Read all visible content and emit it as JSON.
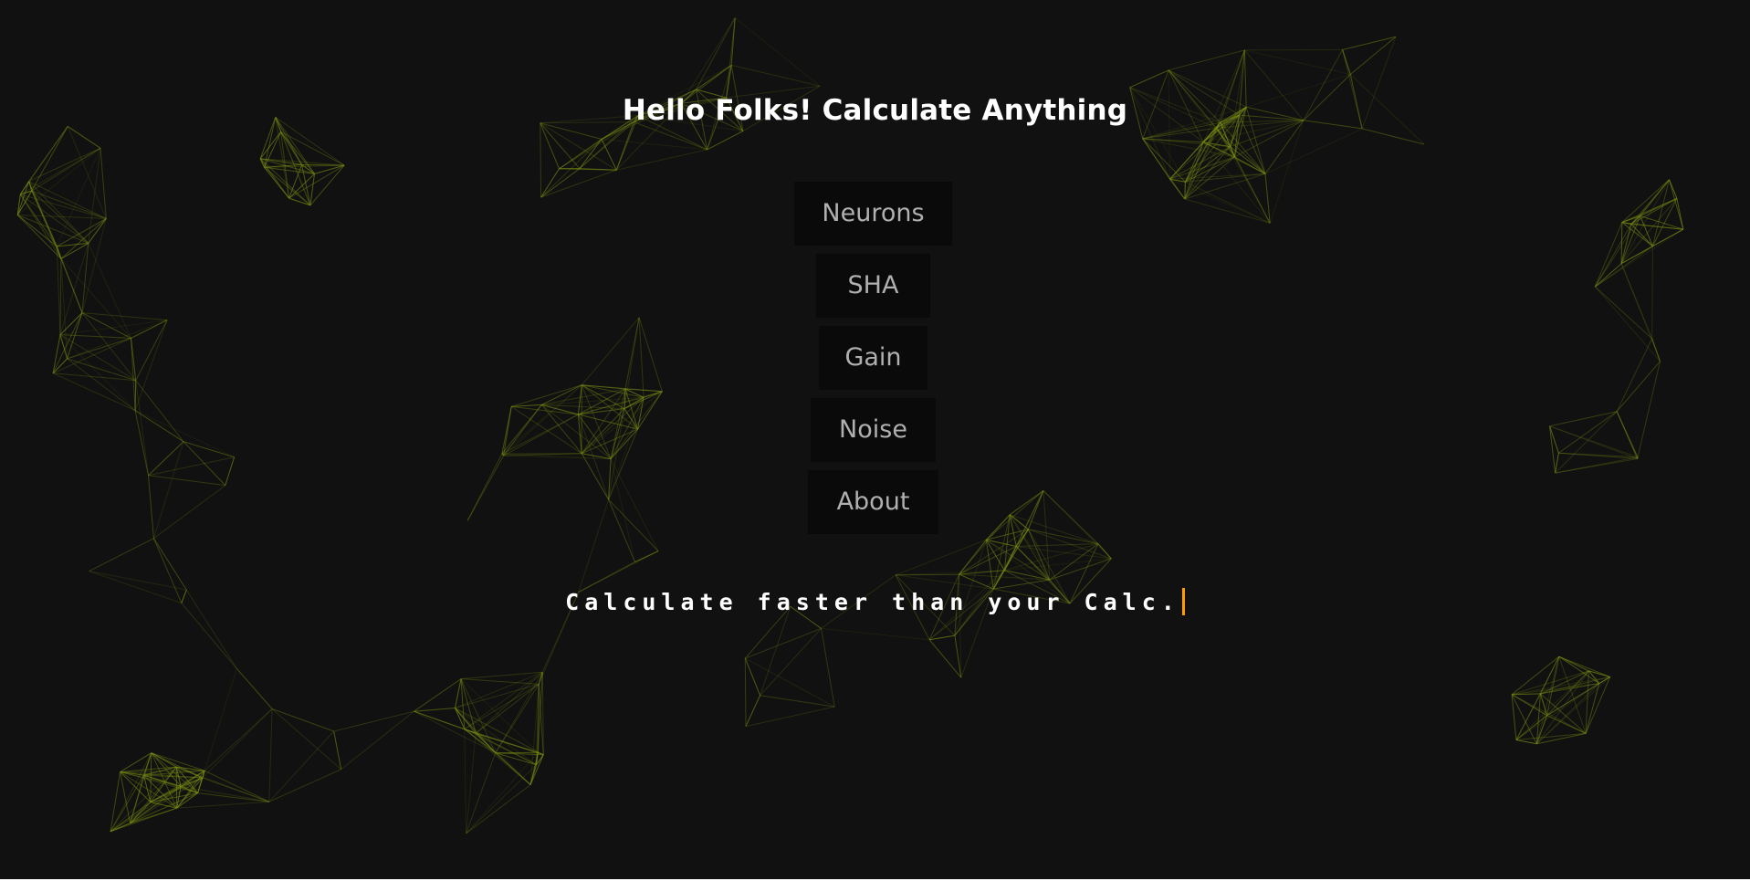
{
  "header": {
    "title": "Hello Folks! Calculate Anything"
  },
  "menu": {
    "items": [
      {
        "label": "Neurons"
      },
      {
        "label": "SHA"
      },
      {
        "label": "Gain"
      },
      {
        "label": "Noise"
      },
      {
        "label": "About"
      }
    ]
  },
  "tagline": {
    "text": "Calculate faster than your Calc."
  },
  "colors": {
    "background": "#111111",
    "network_line": "#7a8f12",
    "caret": "#ff9c00",
    "button_bg": "#0a0a0a",
    "button_text": "#b0b0b0"
  }
}
